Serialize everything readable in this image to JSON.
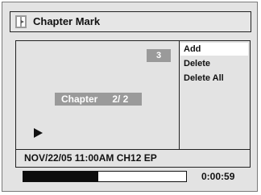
{
  "window": {
    "title": "Chapter Mark",
    "icon": "chapter-mark-icon"
  },
  "preview": {
    "chapter_count": "3",
    "chapter_label": "Chapter",
    "chapter_value": "2/ 2",
    "play_icon": "play-icon"
  },
  "menu": {
    "items": [
      {
        "label": "Add",
        "selected": true
      },
      {
        "label": "Delete",
        "selected": false
      },
      {
        "label": "Delete All",
        "selected": false
      }
    ]
  },
  "status": {
    "info": "NOV/22/05 11:00AM CH12 EP"
  },
  "playback": {
    "progress_percent": 46,
    "time": "0:00:59"
  },
  "colors": {
    "background": "#e3e3e3",
    "highlight": "#9a9a9a",
    "selected_item": "#ffffff",
    "progress_fill": "#0d0d0d"
  }
}
